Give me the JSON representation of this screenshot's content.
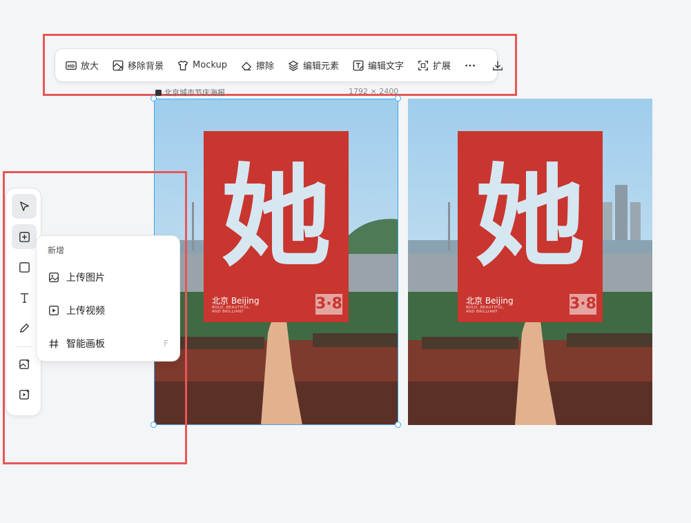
{
  "toolbar": {
    "items": [
      {
        "label": "放大",
        "icon": "hd-icon"
      },
      {
        "label": "移除背景",
        "icon": "remove-bg-icon"
      },
      {
        "label": "Mockup",
        "icon": "tshirt-icon"
      },
      {
        "label": "擦除",
        "icon": "eraser-icon"
      },
      {
        "label": "编辑元素",
        "icon": "layers-icon"
      },
      {
        "label": "编辑文字",
        "icon": "edit-text-icon"
      },
      {
        "label": "扩展",
        "icon": "expand-icon"
      }
    ],
    "more_icon": "ellipsis-icon",
    "download_icon": "download-icon"
  },
  "canvas": {
    "title": "北京城市节庆海报",
    "size": "1792 × 2400"
  },
  "poster": {
    "glyph": "她",
    "city_label": "北京 Beijing",
    "tagline_lines": [
      "BOLD, BEAUTIFUL,",
      "AND BRILLIANT"
    ],
    "date_badge": "3·8"
  },
  "sidebar": {
    "tools": [
      "pointer-icon",
      "add-square-icon",
      "rectangle-icon",
      "text-tool-icon",
      "pen-icon",
      "ai-image-icon",
      "ai-video-icon"
    ]
  },
  "menu": {
    "heading": "新增",
    "items": [
      {
        "label": "上传图片",
        "icon": "image-upload-icon",
        "shortcut": ""
      },
      {
        "label": "上传视频",
        "icon": "video-upload-icon",
        "shortcut": ""
      },
      {
        "label": "智能画板",
        "icon": "hash-icon",
        "shortcut": "F"
      }
    ]
  },
  "colors": {
    "poster_red": "#c8362f",
    "selection_blue": "#3aa6f0",
    "highlight_red": "#e85656"
  }
}
